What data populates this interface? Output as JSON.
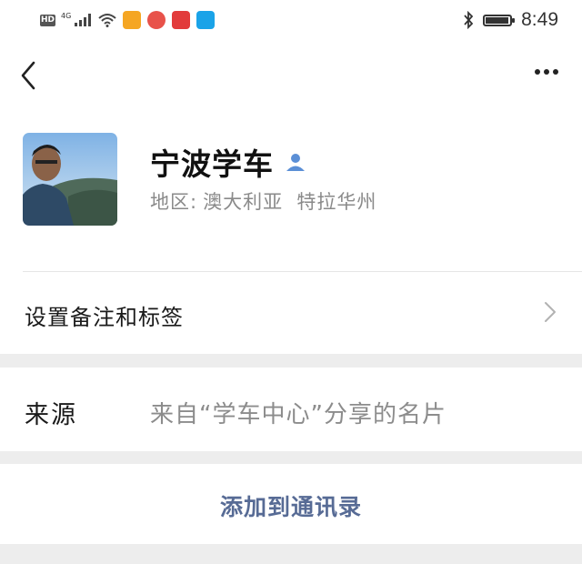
{
  "status_bar": {
    "hd_label": "HD",
    "network_label": "4G",
    "time": "8:49",
    "battery_level": 0.95,
    "app_icons": [
      {
        "name": "video-app-icon",
        "color": "#f5a623"
      },
      {
        "name": "browser-app-icon",
        "color": "#e8524a"
      },
      {
        "name": "shop-app-icon",
        "color": "#e23b3b"
      },
      {
        "name": "search-app-icon",
        "color": "#1aa3e8"
      }
    ]
  },
  "nav": {
    "back_icon": "chevron-left-icon",
    "more_icon": "more-horizontal-icon"
  },
  "profile": {
    "name": "宁波学车",
    "badge_icon": "person-icon",
    "badge_color": "#5b8fd6",
    "region_label": "地区:",
    "region_value": "澳大利亚  特拉华州"
  },
  "rows": {
    "remark_label": "设置备注和标签",
    "source_label": "来源",
    "source_value": "来自“学车中心”分享的名片",
    "add_contact_label": "添加到通讯录"
  },
  "colors": {
    "link": "#576b95",
    "secondary_text": "#8a8a8a",
    "section_gap": "#ededed"
  }
}
